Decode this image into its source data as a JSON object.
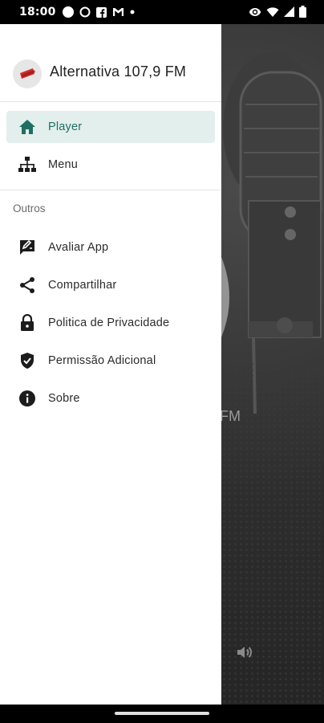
{
  "status_bar": {
    "time": "18:00",
    "left_icons": [
      "circle-icon",
      "ring-icon",
      "facebook-icon",
      "gmail-icon",
      "dot-icon"
    ],
    "right_icons": [
      "eye-icon",
      "wifi-icon",
      "signal-icon",
      "battery-icon"
    ]
  },
  "drawer": {
    "title": "Alternativa 107,9 FM",
    "items": [
      {
        "label": "Player",
        "icon": "home-icon",
        "active": true
      },
      {
        "label": "Menu",
        "icon": "sitemap-icon",
        "active": false
      }
    ],
    "section_label": "Outros",
    "other_items": [
      {
        "label": "Avaliar App",
        "icon": "rate-review-icon"
      },
      {
        "label": "Compartilhar",
        "icon": "share-icon"
      },
      {
        "label": "Politica de Privacidade",
        "icon": "lock-icon"
      },
      {
        "label": "Permissão Adicional",
        "icon": "shield-check-icon"
      },
      {
        "label": "Sobre",
        "icon": "info-icon"
      }
    ]
  },
  "background": {
    "fm_text": "FM",
    "accent": "#1f6f63"
  }
}
